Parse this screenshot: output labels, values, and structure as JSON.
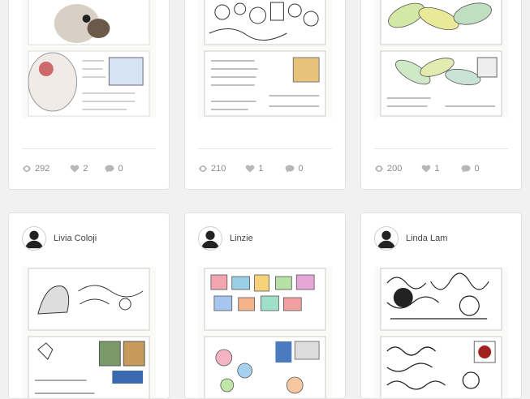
{
  "cards_top": [
    {
      "views": "292",
      "likes": "2",
      "comments": "0"
    },
    {
      "views": "210",
      "likes": "1",
      "comments": "0"
    },
    {
      "views": "200",
      "likes": "1",
      "comments": "0"
    }
  ],
  "cards_bottom": [
    {
      "author": "Livia Coloji"
    },
    {
      "author": "Linzie"
    },
    {
      "author": "Linda Lam"
    }
  ],
  "icons": {
    "views": "eye-icon",
    "likes": "heart-icon",
    "comments": "comment-icon",
    "avatar": "user-avatar-icon"
  }
}
